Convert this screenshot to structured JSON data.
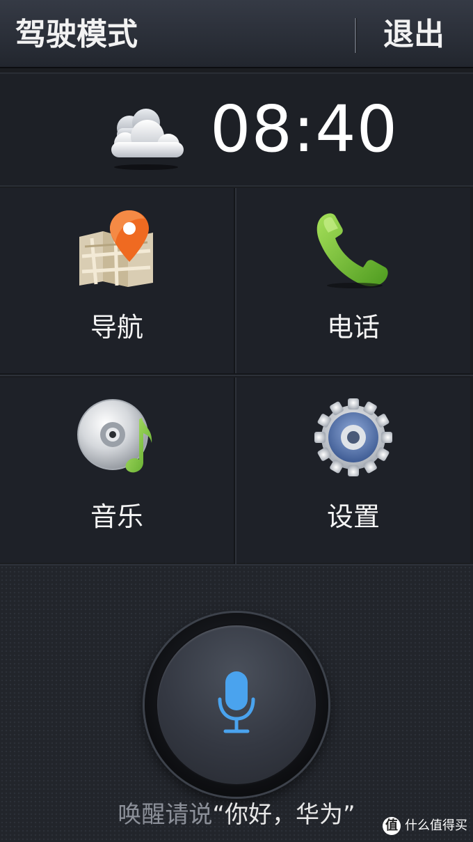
{
  "header": {
    "title": "驾驶模式",
    "exit_label": "退出"
  },
  "status": {
    "weather_icon": "cloud-icon",
    "time": "08:40"
  },
  "tiles": [
    {
      "label": "导航",
      "icon": "map-pin-icon"
    },
    {
      "label": "电话",
      "icon": "phone-icon"
    },
    {
      "label": "音乐",
      "icon": "music-disc-icon"
    },
    {
      "label": "设置",
      "icon": "gear-icon"
    }
  ],
  "voice": {
    "icon": "microphone-icon",
    "hint_prefix": "唤醒请说",
    "hint_phrase": "“你好，华为”"
  },
  "watermark": {
    "badge": "值",
    "text": "什么值得买"
  },
  "colors": {
    "mic_accent": "#4aa3ee",
    "phone_green": "#7cc23a",
    "pin_orange": "#ee6b22"
  }
}
